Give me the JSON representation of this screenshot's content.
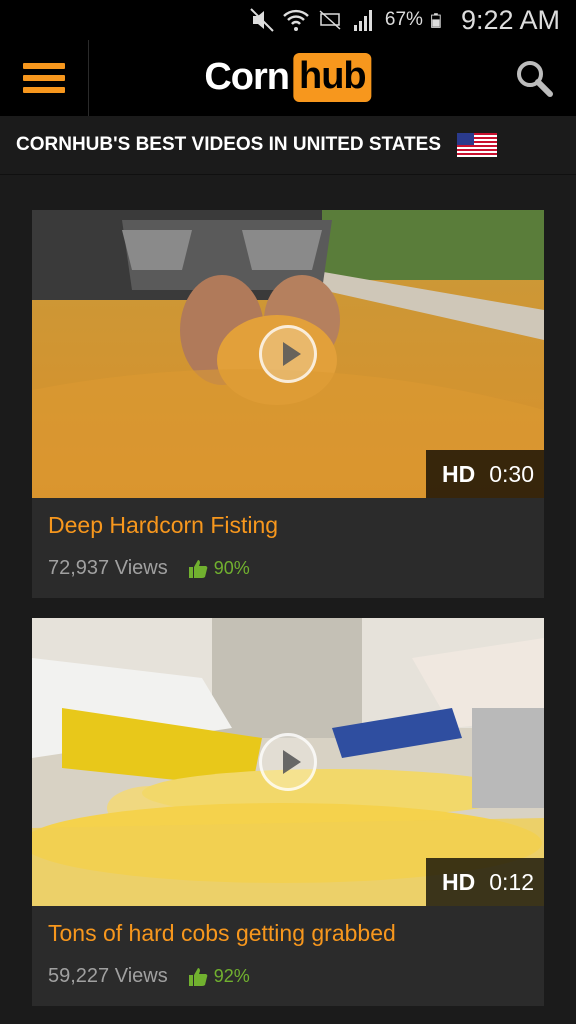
{
  "status_bar": {
    "battery": "67%",
    "time": "9:22 AM"
  },
  "header": {
    "logo_left": "Corn",
    "logo_right": "hub"
  },
  "headline": {
    "text": "CORNHUB'S BEST VIDEOS IN UNITED STATES"
  },
  "videos": [
    {
      "title": "Deep Hardcorn Fisting",
      "views": "72,937 Views",
      "rating": "90%",
      "quality": "HD",
      "duration": "0:30"
    },
    {
      "title": "Tons of hard cobs getting grabbed",
      "views": "59,227 Views",
      "rating": "92%",
      "quality": "HD",
      "duration": "0:12"
    }
  ],
  "colors": {
    "accent": "#f7971d",
    "rating_green": "#71b12f",
    "background": "#1b1b1b",
    "card": "#2b2b2b"
  },
  "icons": [
    "mute-icon",
    "wifi-icon",
    "no-sim-icon",
    "signal-icon",
    "battery-icon",
    "menu-icon",
    "search-icon",
    "us-flag-icon",
    "play-icon",
    "thumbs-up-icon"
  ]
}
